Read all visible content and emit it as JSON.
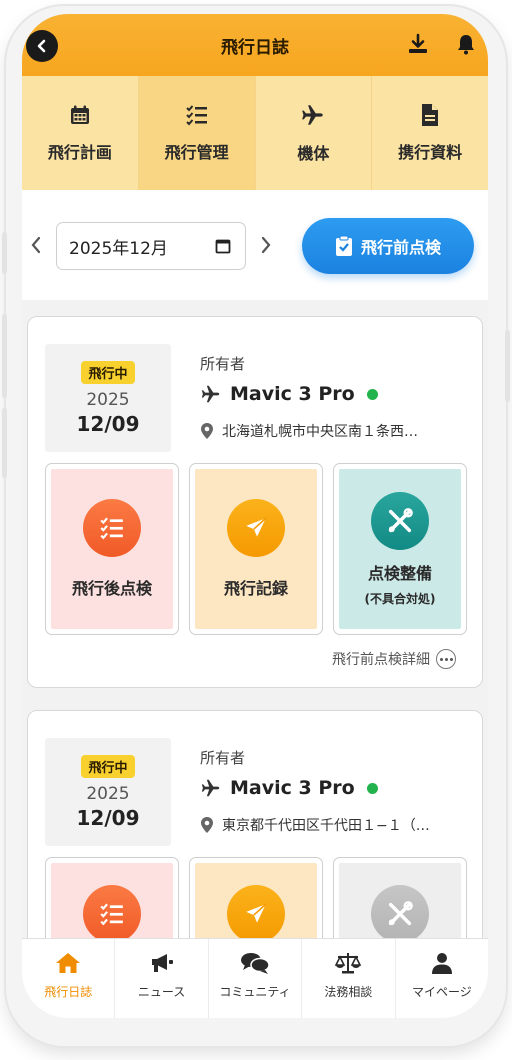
{
  "header": {
    "title": "飛行日誌"
  },
  "tabs": [
    {
      "label": "飛行計画",
      "icon": "calendar-icon"
    },
    {
      "label": "飛行管理",
      "icon": "checklist-icon"
    },
    {
      "label": "機体",
      "icon": "airplane-icon"
    },
    {
      "label": "携行資料",
      "icon": "document-icon"
    }
  ],
  "toolbar": {
    "month_value": "2025年12月",
    "preflight_button": "飛行前点検"
  },
  "cards": [
    {
      "status": "飛行中",
      "year": "2025",
      "date": "12/09",
      "owner_label": "所有者",
      "aircraft": "Mavic 3 Pro",
      "location": "北海道札幌市中央区南１条西…",
      "actions": {
        "post_check": "飛行後点検",
        "flight_record": "飛行記録",
        "maintenance": "点検整備",
        "maintenance_sub": "(不具合対処)"
      },
      "details_link": "飛行前点検詳細"
    },
    {
      "status": "飛行中",
      "year": "2025",
      "date": "12/09",
      "owner_label": "所有者",
      "aircraft": "Mavic 3 Pro",
      "location": "東京都千代田区千代田１−１（…"
    }
  ],
  "bottom_nav": [
    {
      "label": "飛行日誌",
      "icon": "home-icon",
      "active": true
    },
    {
      "label": "ニュース",
      "icon": "megaphone-icon"
    },
    {
      "label": "コミュニティ",
      "icon": "chat-icon"
    },
    {
      "label": "法務相談",
      "icon": "scale-icon"
    },
    {
      "label": "マイページ",
      "icon": "user-icon"
    }
  ],
  "colors": {
    "header": "#f7a61f",
    "tabs_bg": "#fbe3a4",
    "primary_blue": "#1b82e0",
    "status_badge": "#f8d12e",
    "online": "#22b34d",
    "post_check_bg": "#fde0e0",
    "record_bg": "#fde7c2",
    "maintenance_bg": "#cbe9e6",
    "active_nav": "#f08c00"
  }
}
